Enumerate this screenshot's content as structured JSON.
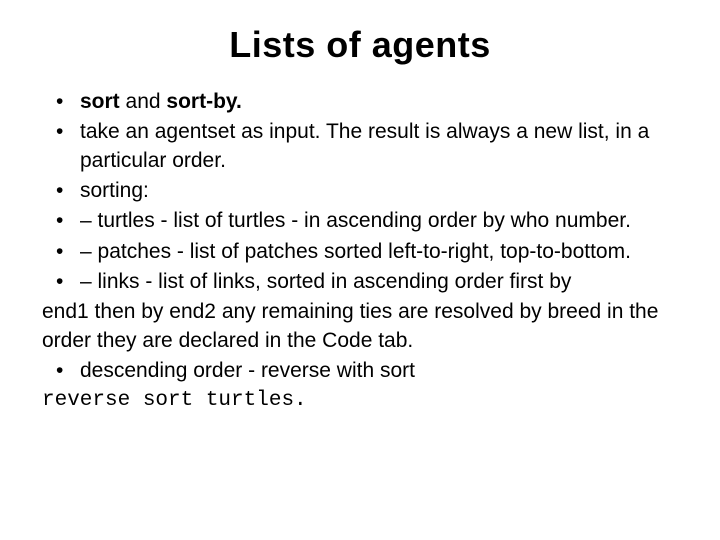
{
  "title": "Lists of agents",
  "b1_bold1": "sort",
  "b1_mid": " and ",
  "b1_bold2": "sort-by.",
  "b2": "take an agentset as input. The result is always a new list, in a particular order.",
  "b3": "sorting:",
  "b4": "– turtles - list of turtles - in ascending order by who number.",
  "b5": "– patches -  list of patches sorted left-to-right, top-to-bottom.",
  "b6_pre": "– links - list of links, sorted in ascending order first by",
  "b6_cont": " end1 then by end2 any remaining ties are resolved by breed in the order they are declared in the Code tab.",
  "b7": "descending order - reverse with sort",
  "code": " reverse sort turtles."
}
